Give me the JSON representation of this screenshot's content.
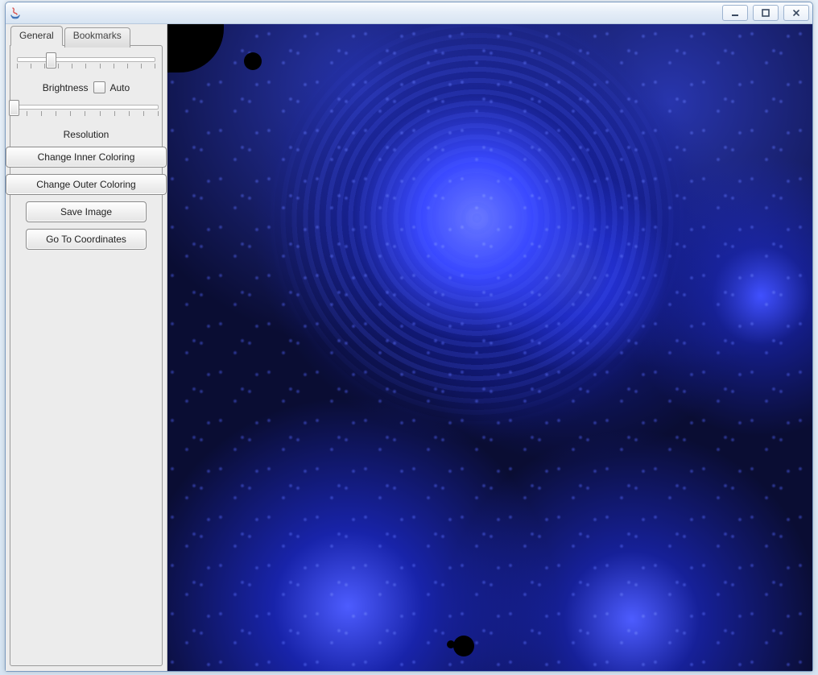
{
  "window": {
    "controls": {
      "minimize": "minimize",
      "maximize": "maximize",
      "close": "close"
    }
  },
  "sidebar": {
    "tabs": [
      {
        "label": "General",
        "active": true
      },
      {
        "label": "Bookmarks",
        "active": false
      }
    ],
    "brightness_label": "Brightness",
    "auto_label": "Auto",
    "auto_checked": false,
    "resolution_label": "Resolution",
    "brightness_slider": {
      "value_pct": 22
    },
    "resolution_slider": {
      "value_pct": 0
    },
    "buttons": {
      "change_inner": "Change Inner Coloring",
      "change_outer": "Change Outer Coloring",
      "save_image": "Save Image",
      "goto_coords": "Go To Coordinates"
    }
  },
  "canvas": {
    "palette": {
      "bg": "#0a0d33",
      "fg": "#3d4dff",
      "hi": "#7a88ff"
    }
  }
}
